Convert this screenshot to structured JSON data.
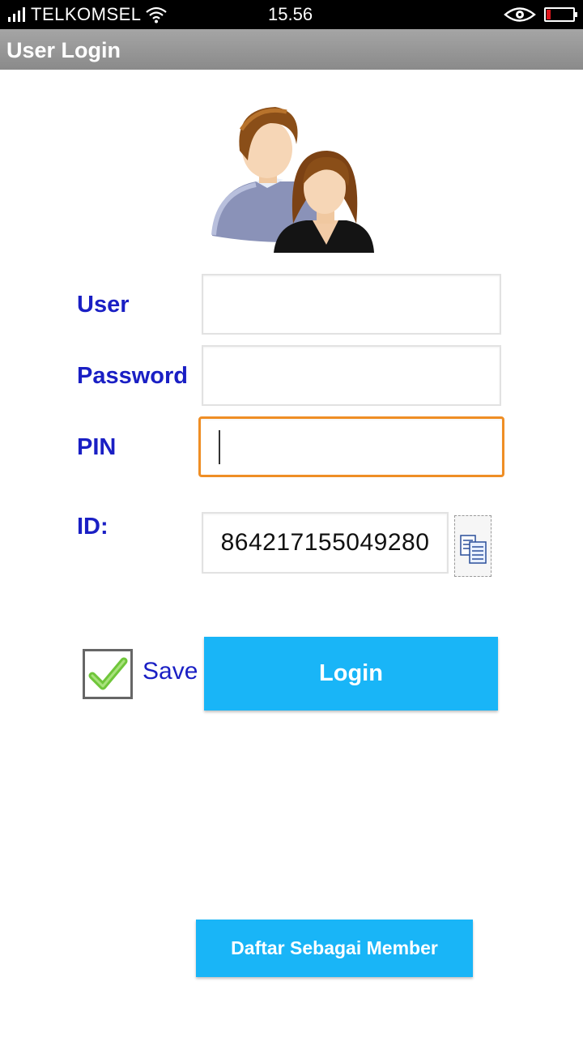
{
  "status_bar": {
    "carrier": "TELKOMSEL",
    "time": "15.56",
    "battery_color": "#e0181e"
  },
  "app_bar": {
    "title": "User Login"
  },
  "form": {
    "user_label": "User",
    "user_value": "",
    "password_label": "Password",
    "password_value": "",
    "pin_label": "PIN",
    "pin_value": "",
    "id_label": "ID:",
    "id_value": "864217155049280",
    "copy_icon": "copy-icon",
    "save_label": "Save",
    "save_checked": true,
    "login_label": "Login",
    "register_label": "Daftar Sebagai Member"
  },
  "colors": {
    "label_blue": "#1a1fc4",
    "button_blue": "#19b5f7",
    "focus_orange": "#ef8e25"
  }
}
